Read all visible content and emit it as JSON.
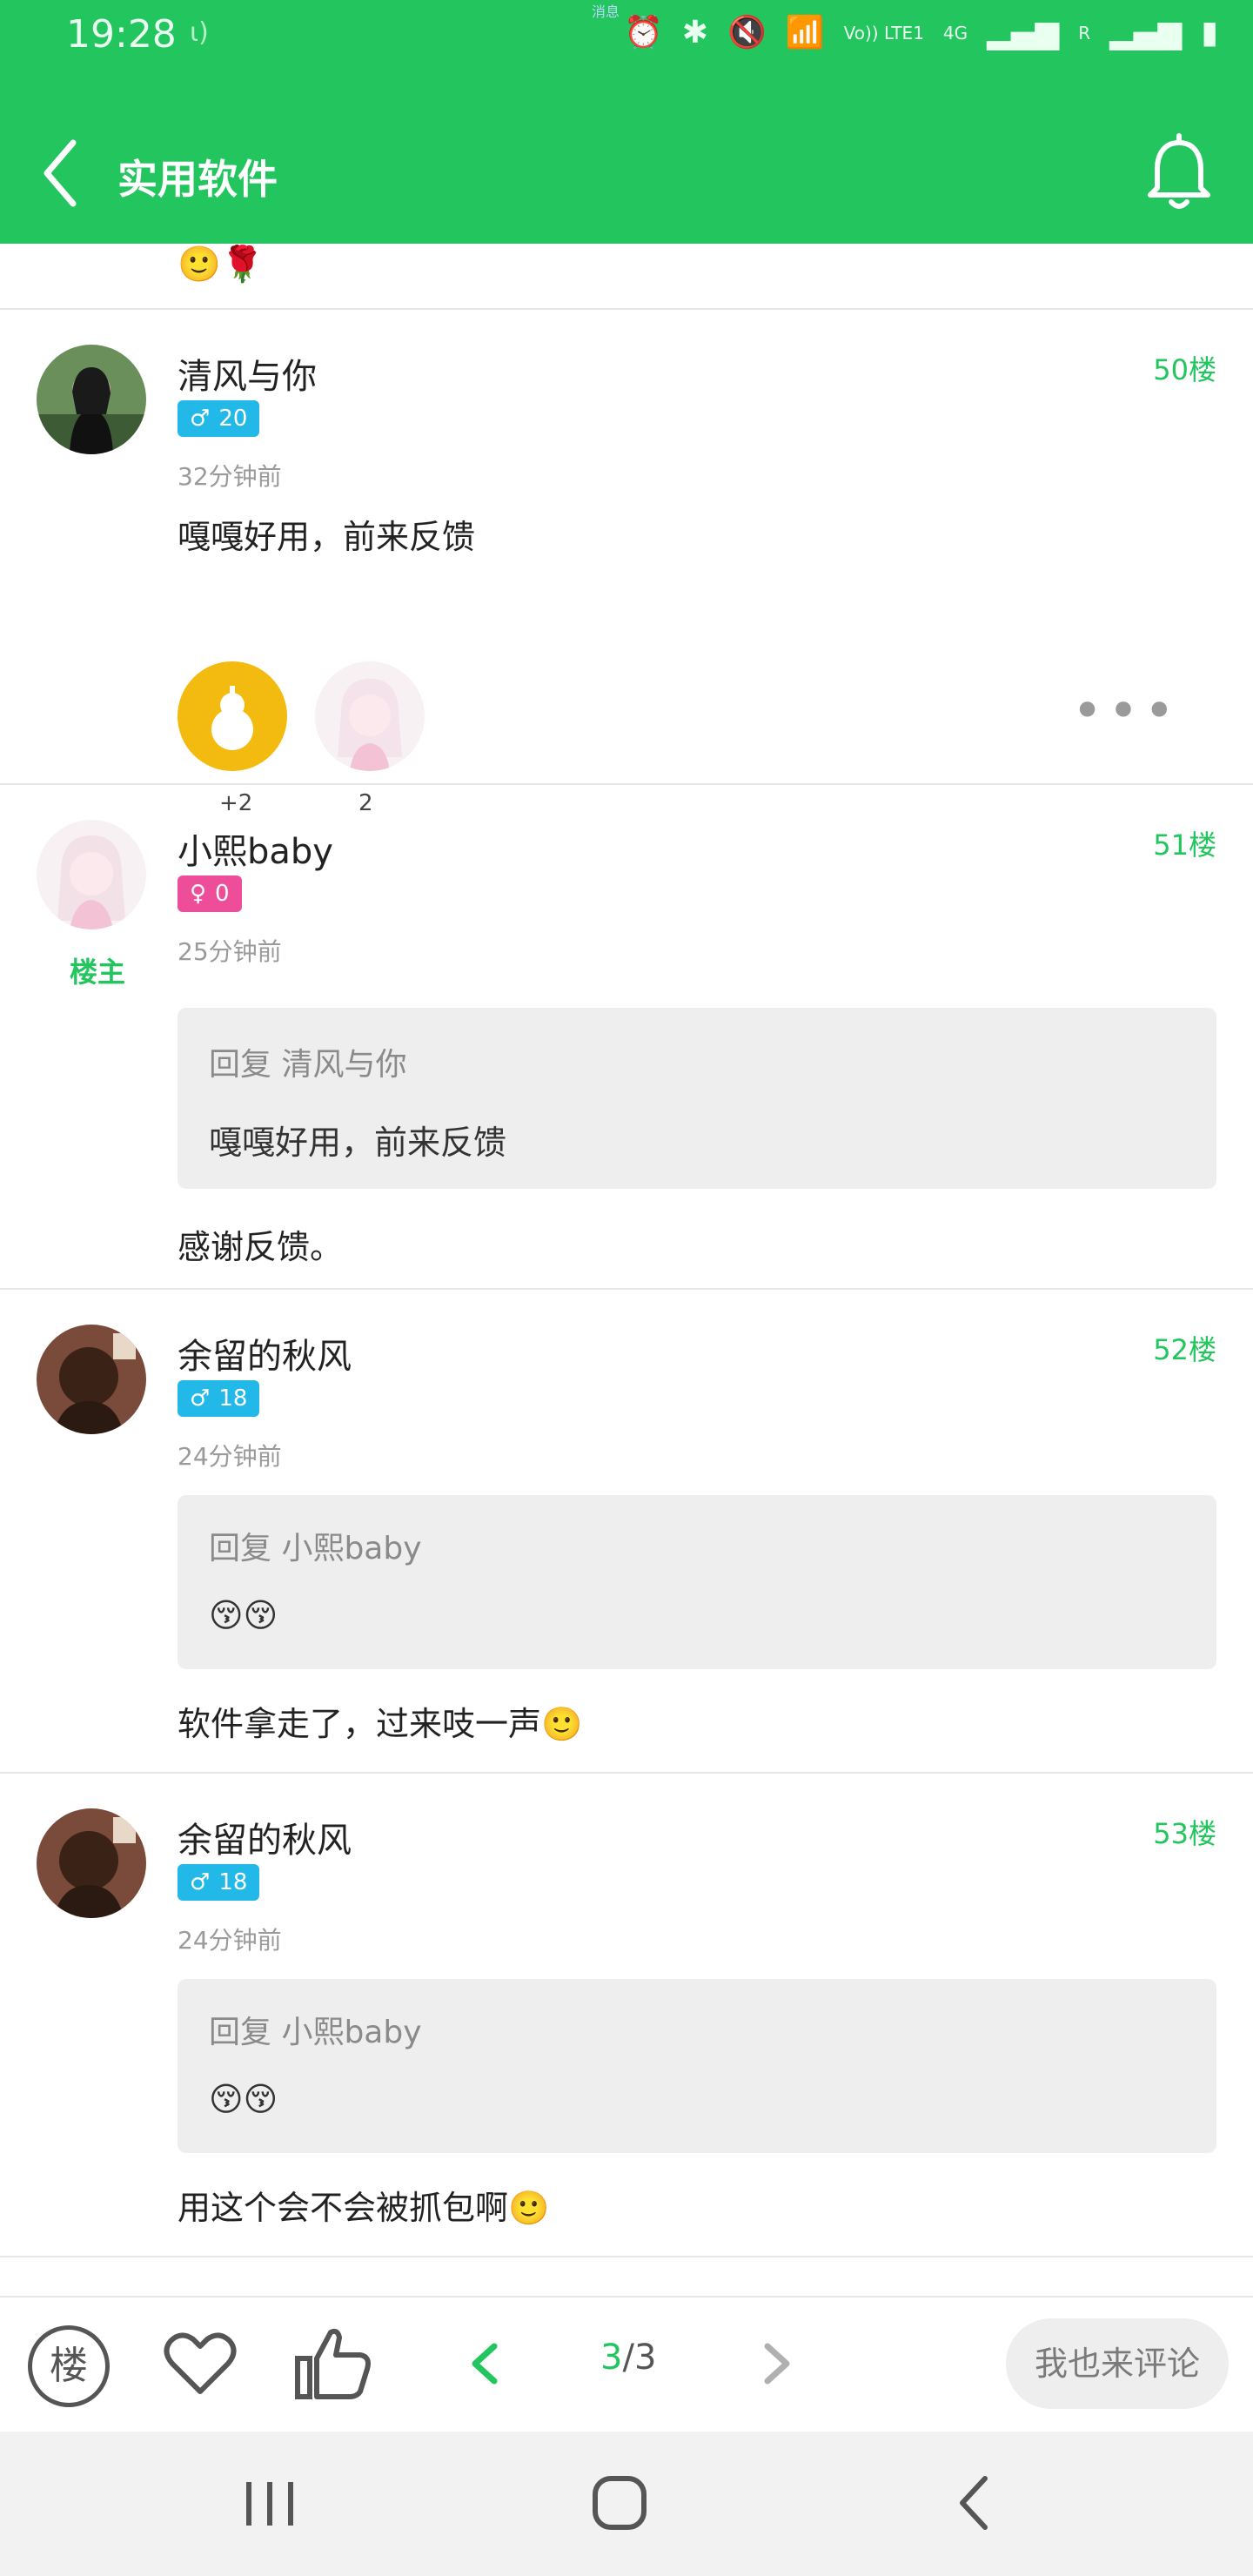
{
  "status_bar": {
    "time": "19:28",
    "network": "Vo)) LTE1",
    "net_type": "4G",
    "roaming": "R",
    "center_text": "消息"
  },
  "header": {
    "title": "实用软件"
  },
  "posts": [
    {
      "username": "清风与你",
      "gender": "male",
      "level": "20",
      "time": "32分钟前",
      "floor": "50楼",
      "content": "嘎嘎好用，前来反馈",
      "rewards": [
        {
          "type": "coin",
          "count": "+2"
        },
        {
          "type": "avatar",
          "count": "2"
        }
      ]
    },
    {
      "username": "小熙baby",
      "gender": "female",
      "level": "0",
      "time": "25分钟前",
      "floor": "51楼",
      "host_label": "楼主",
      "quote": {
        "label": "回复 清风与你",
        "text": "嘎嘎好用，前来反馈"
      },
      "content": "感谢反馈。"
    },
    {
      "username": "余留的秋风",
      "gender": "male",
      "level": "18",
      "time": "24分钟前",
      "floor": "52楼",
      "quote": {
        "label": "回复 小熙baby",
        "text": "😚😚"
      },
      "content": "软件拿走了，过来吱一声🙂"
    },
    {
      "username": "余留的秋风",
      "gender": "male",
      "level": "18",
      "time": "24分钟前",
      "floor": "53楼",
      "quote": {
        "label": "回复 小熙baby",
        "text": "😚😚"
      },
      "content": "用这个会不会被抓包啊🙂"
    }
  ],
  "prev_tail": {
    "emoji": "🙂🌹"
  },
  "bottom_bar": {
    "floor_button": "楼",
    "page_current": "3",
    "page_sep": "/",
    "page_total": "3",
    "comment_button": "我也来评论"
  },
  "colors": {
    "accent": "#22c55e",
    "male_badge": "#22b8e8",
    "female_badge": "#ee4d9a",
    "coin": "#f3bb10"
  }
}
